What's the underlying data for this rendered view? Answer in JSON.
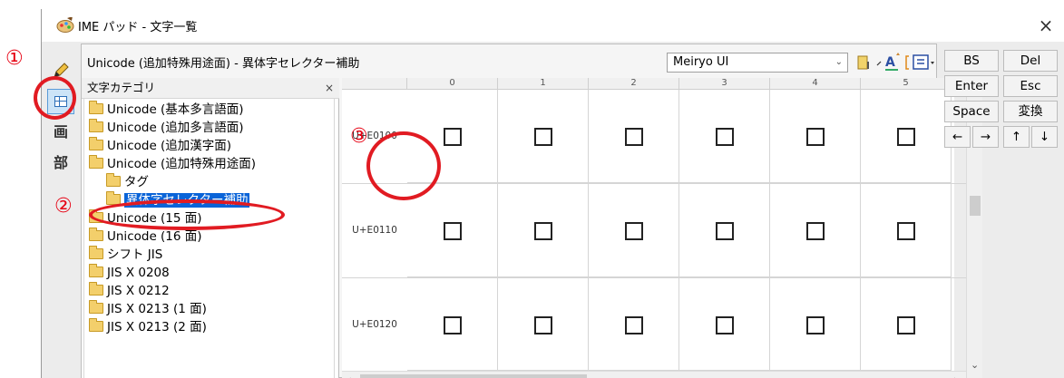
{
  "window": {
    "title": "IME パッド - 文字一覧",
    "close_glyph": "×"
  },
  "mode_bar": {
    "items": [
      {
        "name": "handwriting-mode",
        "glyph": "✎"
      },
      {
        "name": "char-list-mode",
        "glyph": ""
      },
      {
        "name": "stroke-count-mode",
        "glyph": "画"
      },
      {
        "name": "radical-mode",
        "glyph": "部"
      }
    ],
    "stroke_label": "画",
    "radical_label": "部"
  },
  "toolbar": {
    "category_path": "Unicode (追加特殊用途面) - 異体字セレクター補助",
    "font_name": "Meiryo UI",
    "font_chevron": "⌄"
  },
  "tree": {
    "header": "文字カテゴリ",
    "close": "×",
    "items": [
      {
        "label": "Unicode (基本多言語面)"
      },
      {
        "label": "Unicode (追加多言語面)"
      },
      {
        "label": "Unicode (追加漢字面)"
      },
      {
        "label": "Unicode (追加特殊用途面)"
      },
      {
        "label": "タグ"
      },
      {
        "label": "異体字セレクター補助",
        "selected": true
      },
      {
        "label": "Unicode (15 面)"
      },
      {
        "label": "Unicode (16 面)"
      },
      {
        "label": "シフト JIS"
      },
      {
        "label": "JIS X 0208"
      },
      {
        "label": "JIS X 0212"
      },
      {
        "label": "JIS X 0213 (1 面)"
      },
      {
        "label": "JIS X 0213 (2 面)"
      }
    ]
  },
  "grid": {
    "columns": [
      "0",
      "1",
      "2",
      "3",
      "4",
      "5"
    ],
    "rows": [
      "U+E0100",
      "U+E0110",
      "U+E0120"
    ],
    "cell_glyph": "□"
  },
  "keys": {
    "bs": "BS",
    "del": "Del",
    "enter": "Enter",
    "esc": "Esc",
    "space": "Space",
    "convert": "変換",
    "left": "←",
    "right": "→",
    "up": "↑",
    "down": "↓"
  },
  "annotations": {
    "one": "①",
    "two": "②",
    "three": "③"
  },
  "colors": {
    "selection": "#0a64d8",
    "annotation": "#e11b22",
    "folder": "#f3cf6b"
  }
}
